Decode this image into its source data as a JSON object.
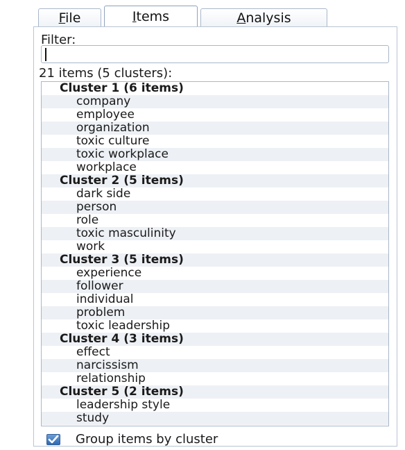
{
  "tabs": [
    {
      "label": "File",
      "mnemonic": "F",
      "rest": "ile",
      "active": false
    },
    {
      "label": "Items",
      "mnemonic": "I",
      "rest": "tems",
      "active": true
    },
    {
      "label": "Analysis",
      "mnemonic": "A",
      "rest": "nalysis",
      "active": false
    }
  ],
  "filter": {
    "label": "Filter:",
    "value": ""
  },
  "summary": "21 items (5 clusters):",
  "clusters": [
    {
      "title": "Cluster 1 (6 items)",
      "items": [
        "company",
        "employee",
        "organization",
        "toxic culture",
        "toxic workplace",
        "workplace"
      ]
    },
    {
      "title": "Cluster 2 (5 items)",
      "items": [
        "dark side",
        "person",
        "role",
        "toxic masculinity",
        "work"
      ]
    },
    {
      "title": "Cluster 3 (5 items)",
      "items": [
        "experience",
        "follower",
        "individual",
        "problem",
        "toxic leadership"
      ]
    },
    {
      "title": "Cluster 4 (3 items)",
      "items": [
        "effect",
        "narcissism",
        "relationship"
      ]
    },
    {
      "title": "Cluster 5 (2 items)",
      "items": [
        "leadership style",
        "study"
      ]
    }
  ],
  "group_checkbox": {
    "label": "Group items by cluster",
    "checked": true
  },
  "colors": {
    "row_alt": "#edf0f4",
    "checkbox_fill": "#2f69b4",
    "border": "#a9b7c9"
  }
}
